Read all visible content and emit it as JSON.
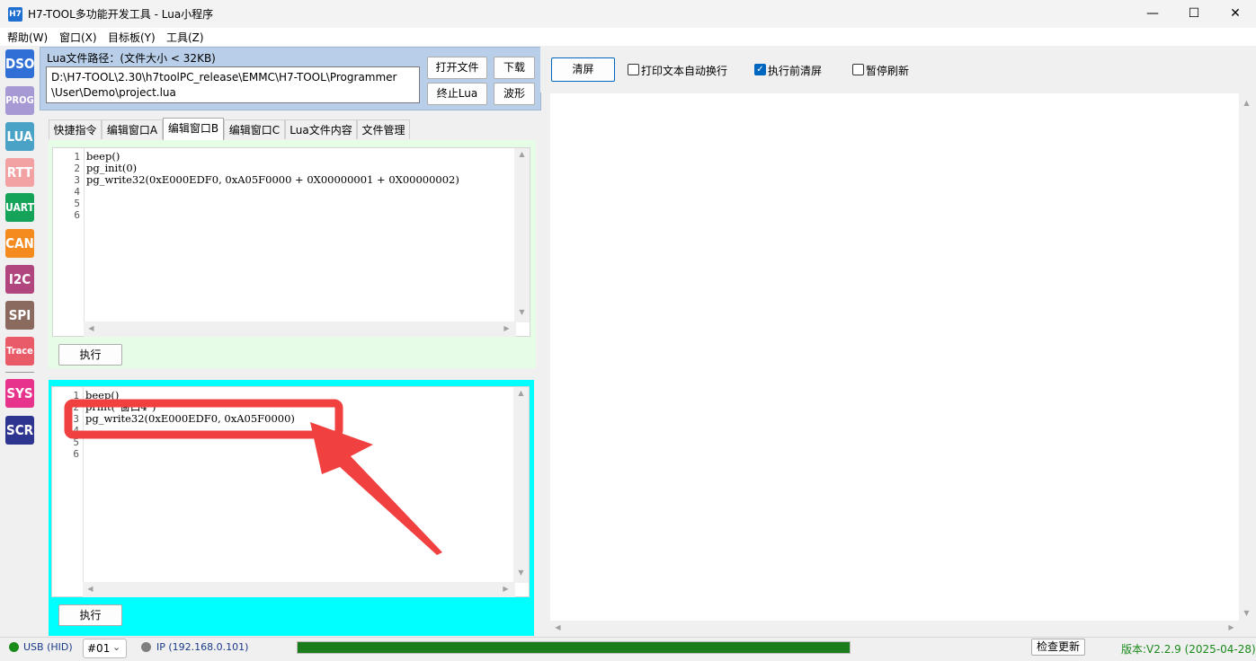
{
  "window": {
    "icon_text": "H7",
    "title": "H7-TOOL多功能开发工具 - Lua小程序",
    "minimize": "—",
    "maximize": "☐",
    "close": "✕"
  },
  "menu": [
    "帮助(W)",
    "窗口(X)",
    "目标板(Y)",
    "工具(Z)"
  ],
  "sidebar": [
    {
      "label": "DSO",
      "color": "#2f6fd6"
    },
    {
      "label": "PROG",
      "color": "#a79ad4"
    },
    {
      "label": "LUA",
      "color": "#4aa3c7"
    },
    {
      "label": "RTT",
      "color": "#f2a2a2"
    },
    {
      "label": "UART",
      "color": "#15a35a"
    },
    {
      "label": "CAN",
      "color": "#f58a1f"
    },
    {
      "label": "I2C",
      "color": "#b0467d"
    },
    {
      "label": "SPI",
      "color": "#8a6a5e"
    },
    {
      "label": "Trace",
      "color": "#ea5b6a"
    },
    {
      "label": "SYS",
      "color": "#e8338c"
    },
    {
      "label": "SCR",
      "color": "#2e3590"
    }
  ],
  "lua_path": {
    "label": "Lua文件路径：(文件大小 < 32KB)",
    "value": "D:\\H7-TOOL\\2.30\\h7toolPC_release\\EMMC\\H7-TOOL\\Programmer\n\\User\\Demo\\project.lua"
  },
  "buttons": {
    "open_file": "打开文件",
    "download": "下载",
    "stop_lua": "终止Lua",
    "waveform": "波形",
    "run_a": "执行",
    "run_b": "执行",
    "clear": "清屏",
    "check_update": "检查更新"
  },
  "tabs": [
    {
      "label": "快捷指令",
      "active": false
    },
    {
      "label": "编辑窗口A",
      "active": false
    },
    {
      "label": "编辑窗口B",
      "active": true
    },
    {
      "label": "编辑窗口C",
      "active": false
    },
    {
      "label": "Lua文件内容",
      "active": false
    },
    {
      "label": "文件管理",
      "active": false
    }
  ],
  "editor_a": {
    "line_numbers": "1\n2\n3\n4\n5\n6",
    "code": "beep()\npg_init(0)\npg_write32(0xE000EDF0, 0xA05F0000 + 0X00000001 + 0X00000002)"
  },
  "editor_b": {
    "line_numbers": "1\n2\n3\n4\n5\n6",
    "code": "beep()\nprint(\"窗口4\")\npg_write32(0xE000EDF0, 0xA05F0000)"
  },
  "options": {
    "auto_wrap": {
      "label": "打印文本自动换行",
      "checked": false
    },
    "clear_before_run": {
      "label": "执行前清屏",
      "checked": true
    },
    "pause_refresh": {
      "label": "暂停刷新",
      "checked": false
    }
  },
  "status": {
    "usb": "USB (HID)",
    "device_no": "#01",
    "ip": "IP (192.168.0.101)",
    "progress": 1.0,
    "version": "版本:V2.2.9 (2025-04-28)",
    "usb_color": "#1a8a1a",
    "ip_color": "#808080"
  },
  "annotation": {
    "color": "#f04040"
  }
}
